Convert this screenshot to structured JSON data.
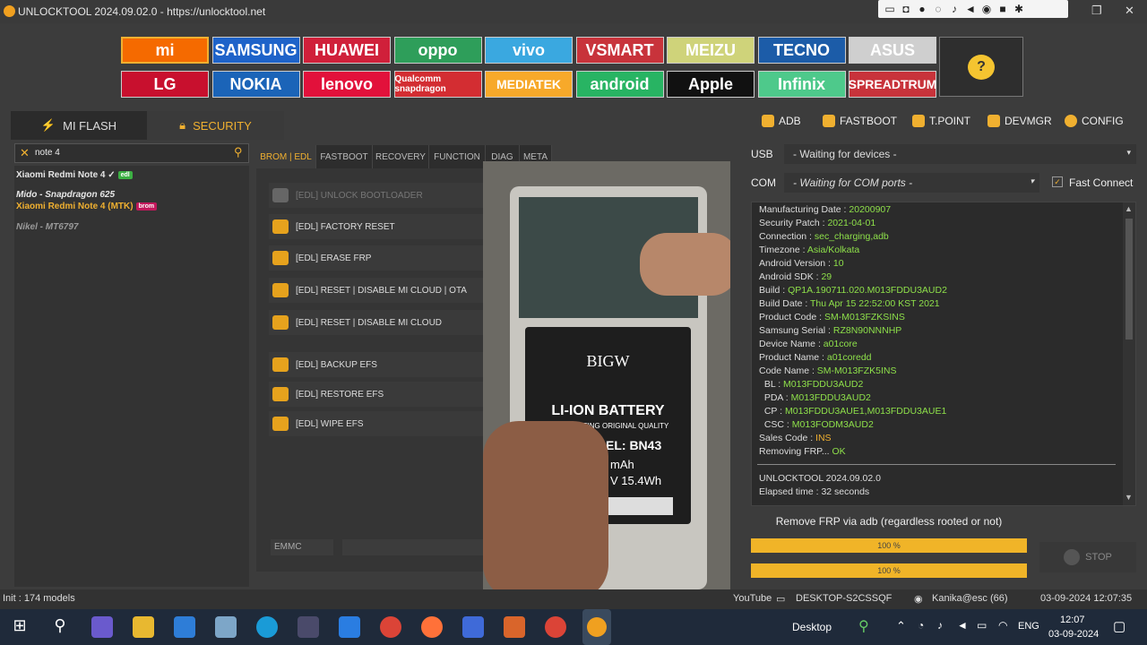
{
  "window": {
    "title": "UNLOCKTOOL 2024.09.02.0 - https://unlocktool.net"
  },
  "brands": [
    {
      "label": "mi",
      "bg": "#f56a00"
    },
    {
      "label": "SAMSUNG",
      "bg": "#1e63c9"
    },
    {
      "label": "HUAWEI",
      "bg": "#d0203a"
    },
    {
      "label": "oppo",
      "bg": "#2e9e5a"
    },
    {
      "label": "vivo",
      "bg": "#3aa8e0"
    },
    {
      "label": "VSMART",
      "bg": "#c8333b"
    },
    {
      "label": "MEIZU",
      "bg": "#cfd37a"
    },
    {
      "label": "TECNO",
      "bg": "#1c5ca8"
    },
    {
      "label": "ASUS",
      "bg": "#cfcfcf"
    },
    {
      "label": "LG",
      "bg": "#c8102e"
    },
    {
      "label": "NOKIA",
      "bg": "#1b64b8"
    },
    {
      "label": "lenovo",
      "bg": "#e2113b"
    },
    {
      "label": "Qualcomm snapdragon",
      "bg": "#d32d32"
    },
    {
      "label": "MEDIATEK",
      "bg": "#f7a92a"
    },
    {
      "label": "android",
      "bg": "#28b463"
    },
    {
      "label": "Apple",
      "bg": "#111111"
    },
    {
      "label": "Infinix",
      "bg": "#4ec98b"
    },
    {
      "label": "SPREADTRUM",
      "bg": "#c8333b"
    }
  ],
  "left_tabs": {
    "mi_flash": "MI FLASH",
    "security": "SECURITY"
  },
  "search": {
    "value": "note 4"
  },
  "models": [
    {
      "name": "Xiaomi Redmi Note 4 ✓",
      "badge": "edl",
      "badge_color": "#3cb043",
      "color": "#e6e6e6"
    },
    {
      "name": "Mido - Snapdragon 625",
      "badge": "",
      "badge_color": "",
      "color": "#e6e6e6"
    },
    {
      "name": "Xiaomi Redmi Note 4 (MTK)",
      "badge": "brom",
      "badge_color": "#c2185b",
      "color": "#f0b030"
    },
    {
      "name": "Nikel - MT6797",
      "badge": "",
      "badge_color": "",
      "color": "#999999"
    }
  ],
  "mid_tabs": [
    "BROM | EDL",
    "FASTBOOT",
    "RECOVERY",
    "FUNCTION",
    "DIAG",
    "META"
  ],
  "functions": [
    {
      "label": "[EDL] UNLOCK BOOTLOADER",
      "disabled": true
    },
    {
      "label": "[EDL] FACTORY RESET",
      "disabled": false
    },
    {
      "label": "[EDL] ERASE FRP",
      "disabled": false
    },
    {
      "label": "[EDL] RESET | DISABLE MI CLOUD | OTA",
      "disabled": false
    },
    {
      "label": "[EDL] RESET | DISABLE MI CLOUD",
      "disabled": false
    },
    {
      "label": "[EDL] BACKUP EFS",
      "disabled": false
    },
    {
      "label": "[EDL] RESTORE EFS",
      "disabled": false
    },
    {
      "label": "[EDL] WIPE EFS",
      "disabled": false
    }
  ],
  "emmc_label": "EMMC",
  "right_tabs": [
    "ADB",
    "FASTBOOT",
    "T.POINT",
    "DEVMGR",
    "CONFIG"
  ],
  "usb": {
    "label": "USB",
    "value": "- Waiting for devices -"
  },
  "com": {
    "label": "COM",
    "value": "- Waiting for COM ports -",
    "fast_connect": "Fast Connect"
  },
  "log": [
    {
      "k": "Manufacturing Date : ",
      "v": "20200907"
    },
    {
      "k": "Security Patch : ",
      "v": "2021-04-01"
    },
    {
      "k": "Connection : ",
      "v": "sec_charging,adb"
    },
    {
      "k": "Timezone : ",
      "v": "Asia/Kolkata"
    },
    {
      "k": "Android Version : ",
      "v": "10"
    },
    {
      "k": "Android SDK : ",
      "v": "29"
    },
    {
      "k": "Build : ",
      "v": "QP1A.190711.020.M013FDDU3AUD2"
    },
    {
      "k": "Build Date : ",
      "v": "Thu Apr 15 22:52:00 KST 2021"
    },
    {
      "k": "Product Code : ",
      "v": "SM-M013FZKSINS"
    },
    {
      "k": "Samsung Serial : ",
      "v": "RZ8N90NNNHP"
    },
    {
      "k": "Device Name : ",
      "v": "a01core"
    },
    {
      "k": "Product Name : ",
      "v": "a01coredd"
    },
    {
      "k": "Code Name : ",
      "v": "SM-M013FZK5INS"
    },
    {
      "k": "  BL : ",
      "v": "M013FDDU3AUD2"
    },
    {
      "k": "  PDA : ",
      "v": "M013FDDU3AUD2"
    },
    {
      "k": "  CP : ",
      "v": "M013FDDU3AUE1,M013FDDU3AUE1"
    },
    {
      "k": "  CSC : ",
      "v": "M013FODM3AUD2"
    },
    {
      "k": "Sales Code : ",
      "v": "INS"
    },
    {
      "k": "Removing FRP... ",
      "v": "OK"
    }
  ],
  "log_footer": {
    "line1": "UNLOCKTOOL 2024.09.02.0",
    "line2": "Elapsed time : 32 seconds"
  },
  "progress": {
    "title": "Remove FRP via adb (regardless rooted or not)",
    "bar1": "100 %",
    "bar2": "100 %",
    "bar1_value": 100,
    "bar2_value": 100
  },
  "stop_label": "STOP",
  "overlay": {
    "brand": "BIGW",
    "battery": "LI-ION BATTERY",
    "quality": "LONG LASTING ORIGINAL QUALITY",
    "model": "EL: BN43",
    "mah": "mAh",
    "voltage": "V  15.4Wh"
  },
  "status": {
    "left": "Init : 174 models",
    "youtube": "YouTube",
    "pc": "DESKTOP-S2CSSQF",
    "user": "Kanika@esc (66)",
    "datetime": "03-09-2024 12:07:35"
  },
  "taskbar": {
    "desktop": "Desktop",
    "lang": "ENG",
    "time": "12:07",
    "date": "03-09-2024"
  }
}
